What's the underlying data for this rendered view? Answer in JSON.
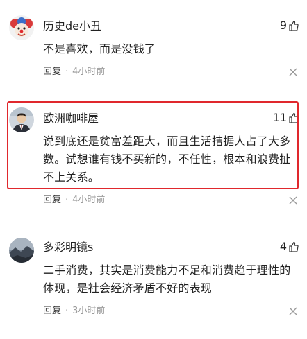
{
  "comments": [
    {
      "username": "历史de小丑",
      "likes": "9",
      "content": "不是喜欢，而是没钱了",
      "reply_label": "回复",
      "separator": "·",
      "time": "4小时前",
      "avatar": "clown-avatar",
      "highlighted": false
    },
    {
      "username": "欧洲咖啡屋",
      "likes": "11",
      "content": "说到底还是贫富差距大，而且生活拮据人占了大多数。试想谁有钱不买新的，不任性，根本和浪费扯不上关系。",
      "reply_label": "回复",
      "separator": "·",
      "time": "4小时前",
      "avatar": "man-in-suit-avatar",
      "highlighted": true
    },
    {
      "username": "多彩明镜s",
      "likes": "4",
      "content": "二手消费，其实是消费能力不足和消费趋于理性的体现，是社会经济矛盾不好的表现",
      "reply_label": "回复",
      "separator": "·",
      "time": "3小时前",
      "avatar": "landscape-avatar",
      "highlighted": false
    }
  ],
  "colors": {
    "highlight_border": "#e0282d",
    "text_primary": "#222222",
    "text_secondary": "#9a9a9a",
    "icon_gray": "#9a9a9a"
  },
  "icons": {
    "like": "thumbs-up-icon",
    "dismiss": "close-icon"
  }
}
